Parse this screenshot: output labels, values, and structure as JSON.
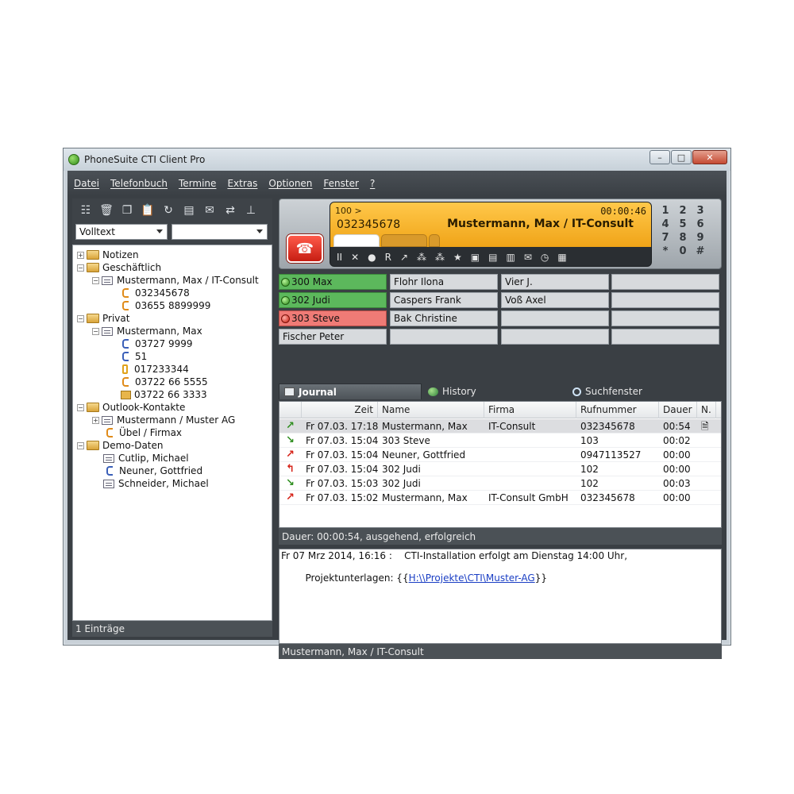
{
  "window": {
    "title": "PhoneSuite CTI Client Pro",
    "controls": [
      "–",
      "□",
      "✕"
    ]
  },
  "menu": [
    "Datei",
    "Telefonbuch",
    "Termine",
    "Extras",
    "Optionen",
    "Fenster",
    "?"
  ],
  "left": {
    "toolbar_icons": [
      "add-contact-icon",
      "delete-icon",
      "copy-icon",
      "paste-icon",
      "refresh-icon",
      "card-icon",
      "mail-icon",
      "sync-icon",
      "pin-icon"
    ],
    "toolbar_glyphs": [
      "☷",
      "🗑",
      "❐",
      "📋",
      "↻",
      "▤",
      "✉",
      "⇄",
      "⊥"
    ],
    "search_mode": "Volltext",
    "search_second": "",
    "tree": [
      {
        "label": "Notizen"
      },
      {
        "label": "Geschäftlich"
      },
      {
        "label": "Mustermann, Max  /  IT-Consult"
      },
      {
        "label": "032345678"
      },
      {
        "label": "03655 8899999"
      },
      {
        "label": "Privat"
      },
      {
        "label": "Mustermann, Max"
      },
      {
        "label": "03727 9999"
      },
      {
        "label": "51"
      },
      {
        "label": "017233344"
      },
      {
        "label": "03722 66 5555"
      },
      {
        "label": "03722 66 3333"
      },
      {
        "label": "Outlook-Kontakte"
      },
      {
        "label": "Mustermann  /  Muster AG"
      },
      {
        "label": "Übel  /  Firmax"
      },
      {
        "label": "Demo-Daten"
      },
      {
        "label": "Cutlip, Michael"
      },
      {
        "label": "Neuner, Gottfried"
      },
      {
        "label": "Schneider, Michael"
      }
    ],
    "status": "1 Einträge"
  },
  "call": {
    "extension": "100 >",
    "timer": "00:00:46",
    "number": "032345678",
    "contact": "Mustermann, Max  /  IT-Consult",
    "actions": [
      "II",
      "✕",
      "●",
      "R",
      "↗",
      "⁂",
      "⁂",
      "★",
      "▣",
      "▤",
      "▥",
      "✉",
      "◷",
      "▦"
    ],
    "keypad": [
      "1",
      "2",
      "3",
      "4",
      "5",
      "6",
      "7",
      "8",
      "9",
      "*",
      "0",
      "#"
    ],
    "hangup_glyph": "☎"
  },
  "blf": [
    {
      "label": "300 Max",
      "state": "green"
    },
    {
      "label": "Flohr Ilona",
      "state": "idle"
    },
    {
      "label": "Vier J.",
      "state": "idle"
    },
    {
      "label": "",
      "state": "idle"
    },
    {
      "label": "302 Judi",
      "state": "green"
    },
    {
      "label": "Caspers Frank",
      "state": "idle"
    },
    {
      "label": "Voß Axel",
      "state": "idle"
    },
    {
      "label": "",
      "state": "idle"
    },
    {
      "label": "303 Steve",
      "state": "red"
    },
    {
      "label": "Bak Christine",
      "state": "idle"
    },
    {
      "label": "",
      "state": "idle"
    },
    {
      "label": "",
      "state": "idle"
    },
    {
      "label": "Fischer Peter",
      "state": "idle"
    },
    {
      "label": "",
      "state": "idle"
    },
    {
      "label": "",
      "state": "idle"
    },
    {
      "label": "",
      "state": "idle"
    }
  ],
  "tabs": {
    "journal": "Journal",
    "history": "History",
    "search": "Suchfenster"
  },
  "journal": {
    "headers": [
      "Zeit",
      "Name",
      "Firma",
      "Rufnummer",
      "Dauer",
      "N."
    ],
    "rows": [
      {
        "dir": "in",
        "glyph": "↗",
        "time": "Fr 07.03. 17:18",
        "name": "Mustermann, Max",
        "firm": "IT-Consult",
        "number": "032345678",
        "duration": "00:54",
        "note": "🗎"
      },
      {
        "dir": "in",
        "glyph": "↘",
        "time": "Fr 07.03. 15:04",
        "name": "303 Steve",
        "firm": "",
        "number": "103",
        "duration": "00:02",
        "note": ""
      },
      {
        "dir": "out",
        "glyph": "↗",
        "time": "Fr 07.03. 15:04",
        "name": "Neuner, Gottfried",
        "firm": "",
        "number": "0947113527",
        "duration": "00:00",
        "note": ""
      },
      {
        "dir": "out",
        "glyph": "↰",
        "time": "Fr 07.03. 15:04",
        "name": "302 Judi",
        "firm": "",
        "number": "102",
        "duration": "00:00",
        "note": ""
      },
      {
        "dir": "in",
        "glyph": "↘",
        "time": "Fr 07.03. 15:03",
        "name": "302 Judi",
        "firm": "",
        "number": "102",
        "duration": "00:03",
        "note": ""
      },
      {
        "dir": "out",
        "glyph": "↗",
        "time": "Fr 07.03. 15:02",
        "name": "Mustermann, Max",
        "firm": "IT-Consult GmbH",
        "number": "032345678",
        "duration": "00:00",
        "note": ""
      }
    ],
    "summary": "Dauer: 00:00:54, ausgehend, erfolgreich"
  },
  "notes": {
    "line1": "Fr 07 Mrz 2014, 16:16 :    CTI-Installation erfolgt am Dienstag 14:00 Uhr,",
    "line2_prefix": "Projektunterlagen: {{",
    "line2_link": "H:\\\\Projekte\\CTI\\Muster-AG",
    "line2_suffix": "}}"
  },
  "right_status": "Mustermann, Max  /  IT-Consult"
}
